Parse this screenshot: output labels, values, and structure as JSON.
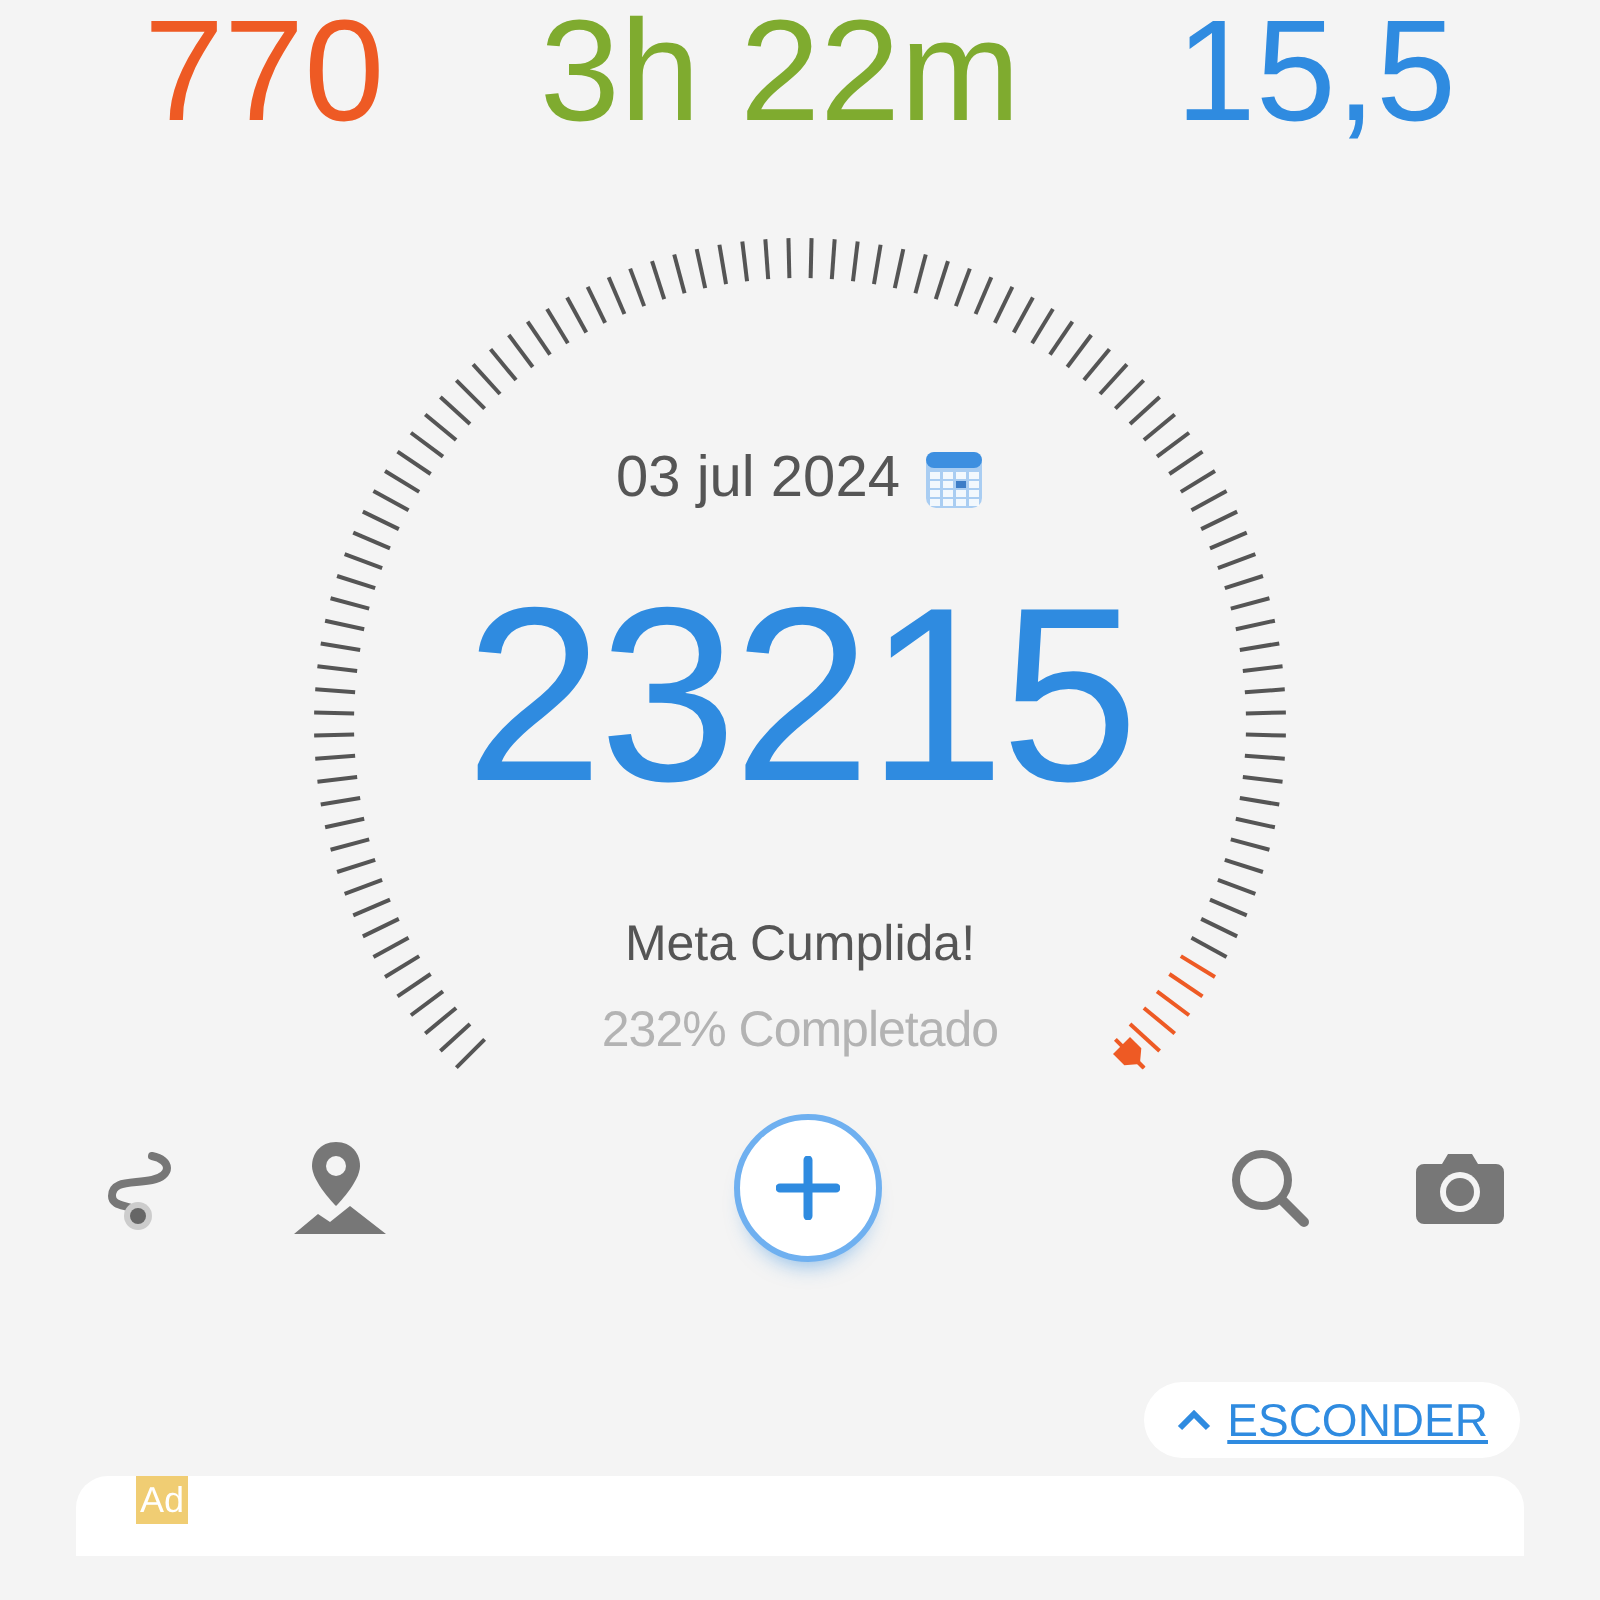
{
  "stats": [
    {
      "value": "770",
      "color": "#ee5a24"
    },
    {
      "value": "3h 22m",
      "color": "#7fab2f"
    },
    {
      "value": "15,5",
      "color": "#2f8be0"
    }
  ],
  "gauge": {
    "date": "03 jul 2024",
    "steps": "23215",
    "status": "Meta Cumplida!",
    "percent": "232% Completado"
  },
  "toolbar": [
    {
      "kind": "route"
    },
    {
      "kind": "map"
    },
    {
      "kind": "add"
    },
    {
      "kind": "search"
    },
    {
      "kind": "camera"
    }
  ],
  "hide_button": {
    "label": "ESCONDER"
  },
  "ad": {
    "badge": "Ad"
  }
}
